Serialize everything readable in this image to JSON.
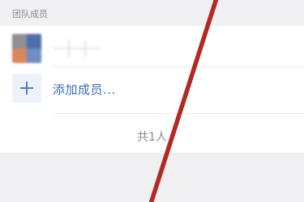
{
  "section": {
    "title": "团队成员"
  },
  "add_member": {
    "label": "添加成员..."
  },
  "footer": {
    "count_text": "共1人"
  },
  "icons": {
    "add": "plus-icon"
  },
  "colors": {
    "accent": "#386cb5",
    "strike": "#b22a22"
  }
}
